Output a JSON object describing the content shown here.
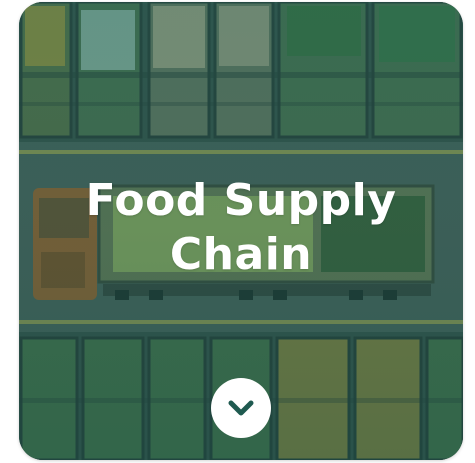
{
  "card": {
    "title_line1": "Food Supply",
    "title_line2": "Chain"
  },
  "scroll_button": {
    "icon": "chevron-down-icon"
  },
  "colors": {
    "overlay_teal": "#146e5f",
    "title_text": "#ffffff",
    "button_bg": "#ffffff",
    "chevron": "#1f5a50"
  }
}
